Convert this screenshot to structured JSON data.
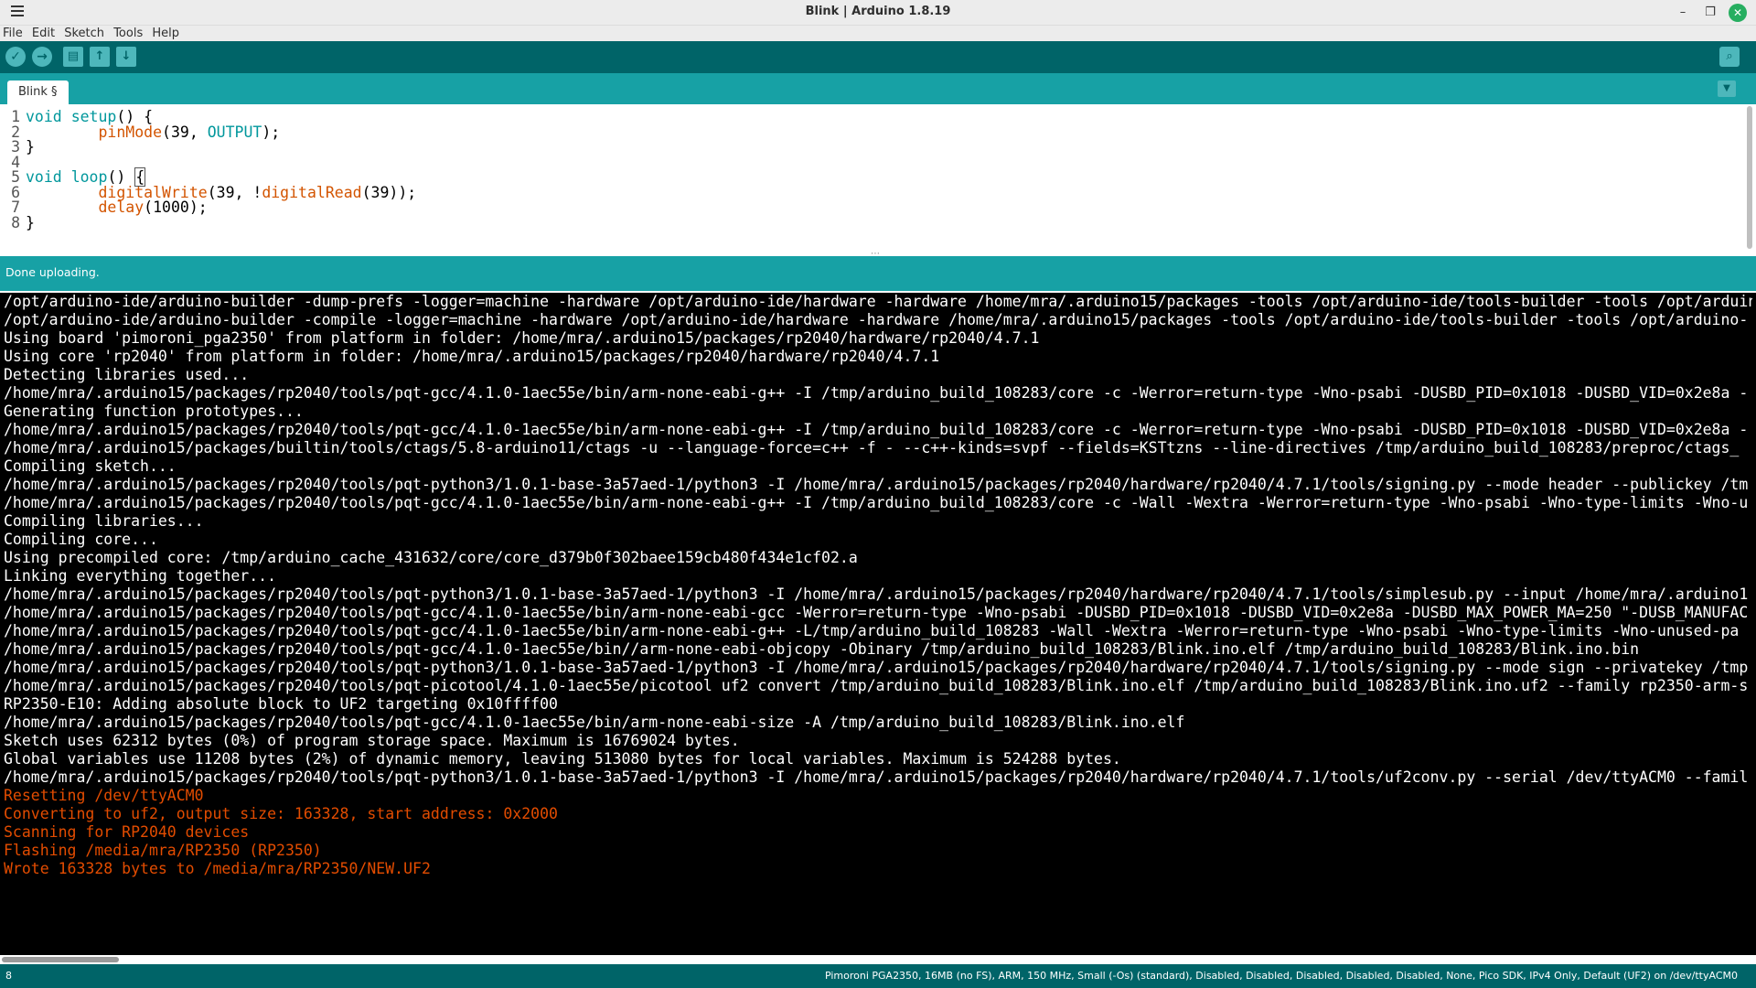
{
  "window": {
    "title": "Blink | Arduino 1.8.19"
  },
  "menu": {
    "items": [
      "File",
      "Edit",
      "Sketch",
      "Tools",
      "Help"
    ]
  },
  "toolbar": {
    "verify": "✓",
    "upload": "→",
    "new": "▤",
    "open": "↑",
    "save": "↓",
    "monitor": "⌕"
  },
  "tabs": {
    "active": "Blink §",
    "menu_glyph": "▼"
  },
  "editor": {
    "lines": [
      {
        "n": "1",
        "parts": [
          [
            "kw",
            "void"
          ],
          [
            "plain",
            " "
          ],
          [
            "kw",
            "setup"
          ],
          [
            "plain",
            "() {"
          ]
        ]
      },
      {
        "n": "2",
        "parts": [
          [
            "plain",
            "        "
          ],
          [
            "fn",
            "pinMode"
          ],
          [
            "plain",
            "(39, "
          ],
          [
            "cst",
            "OUTPUT"
          ],
          [
            "plain",
            ");"
          ]
        ]
      },
      {
        "n": "3",
        "parts": [
          [
            "plain",
            "}"
          ]
        ]
      },
      {
        "n": "4",
        "parts": [
          [
            "plain",
            ""
          ]
        ]
      },
      {
        "n": "5",
        "parts": [
          [
            "kw",
            "void"
          ],
          [
            "plain",
            " "
          ],
          [
            "kw",
            "loop"
          ],
          [
            "plain",
            "() "
          ],
          [
            "cursor",
            "{"
          ]
        ]
      },
      {
        "n": "6",
        "parts": [
          [
            "plain",
            "        "
          ],
          [
            "fn",
            "digitalWrite"
          ],
          [
            "plain",
            "(39, !"
          ],
          [
            "fn",
            "digitalRead"
          ],
          [
            "plain",
            "(39));"
          ]
        ]
      },
      {
        "n": "7",
        "parts": [
          [
            "plain",
            "        "
          ],
          [
            "fn",
            "delay"
          ],
          [
            "plain",
            "(1000);"
          ]
        ]
      },
      {
        "n": "8",
        "parts": [
          [
            "plain",
            "}"
          ]
        ]
      }
    ]
  },
  "status": {
    "message": "Done uploading."
  },
  "console": {
    "lines": [
      {
        "t": "normal",
        "text": "/opt/arduino-ide/arduino-builder -dump-prefs -logger=machine -hardware /opt/arduino-ide/hardware -hardware /home/mra/.arduino15/packages -tools /opt/arduino-ide/tools-builder -tools /opt/arduino-"
      },
      {
        "t": "normal",
        "text": "/opt/arduino-ide/arduino-builder -compile -logger=machine -hardware /opt/arduino-ide/hardware -hardware /home/mra/.arduino15/packages -tools /opt/arduino-ide/tools-builder -tools /opt/arduino-"
      },
      {
        "t": "normal",
        "text": "Using board 'pimoroni_pga2350' from platform in folder: /home/mra/.arduino15/packages/rp2040/hardware/rp2040/4.7.1"
      },
      {
        "t": "normal",
        "text": "Using core 'rp2040' from platform in folder: /home/mra/.arduino15/packages/rp2040/hardware/rp2040/4.7.1"
      },
      {
        "t": "normal",
        "text": "Detecting libraries used..."
      },
      {
        "t": "normal",
        "text": "/home/mra/.arduino15/packages/rp2040/tools/pqt-gcc/4.1.0-1aec55e/bin/arm-none-eabi-g++ -I /tmp/arduino_build_108283/core -c -Werror=return-type -Wno-psabi -DUSBD_PID=0x1018 -DUSBD_VID=0x2e8a -"
      },
      {
        "t": "normal",
        "text": "Generating function prototypes..."
      },
      {
        "t": "normal",
        "text": "/home/mra/.arduino15/packages/rp2040/tools/pqt-gcc/4.1.0-1aec55e/bin/arm-none-eabi-g++ -I /tmp/arduino_build_108283/core -c -Werror=return-type -Wno-psabi -DUSBD_PID=0x1018 -DUSBD_VID=0x2e8a -"
      },
      {
        "t": "normal",
        "text": "/home/mra/.arduino15/packages/builtin/tools/ctags/5.8-arduino11/ctags -u --language-force=c++ -f - --c++-kinds=svpf --fields=KSTtzns --line-directives /tmp/arduino_build_108283/preproc/ctags_"
      },
      {
        "t": "normal",
        "text": "Compiling sketch..."
      },
      {
        "t": "normal",
        "text": "/home/mra/.arduino15/packages/rp2040/tools/pqt-python3/1.0.1-base-3a57aed-1/python3 -I /home/mra/.arduino15/packages/rp2040/hardware/rp2040/4.7.1/tools/signing.py --mode header --publickey /tm"
      },
      {
        "t": "normal",
        "text": "/home/mra/.arduino15/packages/rp2040/tools/pqt-gcc/4.1.0-1aec55e/bin/arm-none-eabi-g++ -I /tmp/arduino_build_108283/core -c -Wall -Wextra -Werror=return-type -Wno-psabi -Wno-type-limits -Wno-u"
      },
      {
        "t": "normal",
        "text": "Compiling libraries..."
      },
      {
        "t": "normal",
        "text": "Compiling core..."
      },
      {
        "t": "normal",
        "text": "Using precompiled core: /tmp/arduino_cache_431632/core/core_d379b0f302baee159cb480f434e1cf02.a"
      },
      {
        "t": "normal",
        "text": "Linking everything together..."
      },
      {
        "t": "normal",
        "text": "/home/mra/.arduino15/packages/rp2040/tools/pqt-python3/1.0.1-base-3a57aed-1/python3 -I /home/mra/.arduino15/packages/rp2040/hardware/rp2040/4.7.1/tools/simplesub.py --input /home/mra/.arduino1"
      },
      {
        "t": "normal",
        "text": "/home/mra/.arduino15/packages/rp2040/tools/pqt-gcc/4.1.0-1aec55e/bin/arm-none-eabi-gcc -Werror=return-type -Wno-psabi -DUSBD_PID=0x1018 -DUSBD_VID=0x2e8a -DUSBD_MAX_POWER_MA=250 \"-DUSB_MANUFAC"
      },
      {
        "t": "normal",
        "text": "/home/mra/.arduino15/packages/rp2040/tools/pqt-gcc/4.1.0-1aec55e/bin/arm-none-eabi-g++ -L/tmp/arduino_build_108283 -Wall -Wextra -Werror=return-type -Wno-psabi -Wno-type-limits -Wno-unused-pa"
      },
      {
        "t": "normal",
        "text": "/home/mra/.arduino15/packages/rp2040/tools/pqt-gcc/4.1.0-1aec55e/bin//arm-none-eabi-objcopy -Obinary /tmp/arduino_build_108283/Blink.ino.elf /tmp/arduino_build_108283/Blink.ino.bin"
      },
      {
        "t": "normal",
        "text": "/home/mra/.arduino15/packages/rp2040/tools/pqt-python3/1.0.1-base-3a57aed-1/python3 -I /home/mra/.arduino15/packages/rp2040/hardware/rp2040/4.7.1/tools/signing.py --mode sign --privatekey /tmp"
      },
      {
        "t": "normal",
        "text": "/home/mra/.arduino15/packages/rp2040/tools/pqt-picotool/4.1.0-1aec55e/picotool uf2 convert /tmp/arduino_build_108283/Blink.ino.elf /tmp/arduino_build_108283/Blink.ino.uf2 --family rp2350-arm-s"
      },
      {
        "t": "normal",
        "text": "RP2350-E10: Adding absolute block to UF2 targeting 0x10ffff00"
      },
      {
        "t": "normal",
        "text": "/home/mra/.arduino15/packages/rp2040/tools/pqt-gcc/4.1.0-1aec55e/bin/arm-none-eabi-size -A /tmp/arduino_build_108283/Blink.ino.elf"
      },
      {
        "t": "normal",
        "text": "Sketch uses 62312 bytes (0%) of program storage space. Maximum is 16769024 bytes."
      },
      {
        "t": "normal",
        "text": "Global variables use 11208 bytes (2%) of dynamic memory, leaving 513080 bytes for local variables. Maximum is 524288 bytes."
      },
      {
        "t": "normal",
        "text": "/home/mra/.arduino15/packages/rp2040/tools/pqt-python3/1.0.1-base-3a57aed-1/python3 -I /home/mra/.arduino15/packages/rp2040/hardware/rp2040/4.7.1/tools/uf2conv.py --serial /dev/ttyACM0 --famil"
      },
      {
        "t": "error",
        "text": "Resetting /dev/ttyACM0"
      },
      {
        "t": "error",
        "text": "Converting to uf2, output size: 163328, start address: 0x2000"
      },
      {
        "t": "error",
        "text": "Scanning for RP2040 devices"
      },
      {
        "t": "error",
        "text": "Flashing /media/mra/RP2350 (RP2350)"
      },
      {
        "t": "error",
        "text": "Wrote 163328 bytes to /media/mra/RP2350/NEW.UF2"
      }
    ]
  },
  "bottom": {
    "line_number": "8",
    "board_info": "Pimoroni PGA2350, 16MB (no FS), ARM, 150 MHz, Small (-Os) (standard), Disabled, Disabled, Disabled, Disabled, Disabled, None, Pico SDK, IPv4 Only, Default (UF2) on /dev/ttyACM0"
  },
  "colors": {
    "toolbar_bg": "#006468",
    "tabstrip_bg": "#17a1a5",
    "keyword": "#00979c",
    "function": "#d35400",
    "console_error": "#e34c00"
  }
}
